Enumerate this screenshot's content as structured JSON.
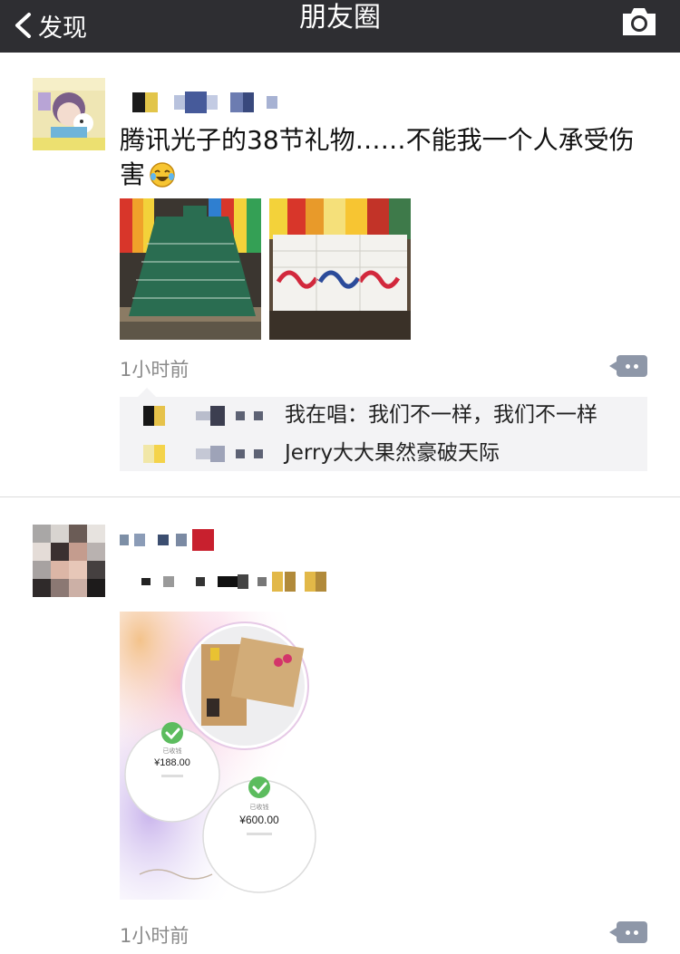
{
  "nav": {
    "back_label": "发现",
    "title": "朋友圈",
    "camera_icon": "camera-icon"
  },
  "posts": [
    {
      "text": "腾讯光子的38节礼物……不能我一个人承受伤害",
      "emoji": "face-with-tears-of-joy",
      "time": "1小时前",
      "comments": [
        {
          "text": "我在唱：我们不一样，我们不一样"
        },
        {
          "text": "Jerry大大果然豪破天际"
        }
      ]
    },
    {
      "time": "1小时前",
      "receipts": [
        {
          "status": "已收钱",
          "amount": "¥188.00"
        },
        {
          "status": "已收钱",
          "amount": "¥600.00"
        }
      ]
    }
  ],
  "colors": {
    "navbar": "#2e2e32",
    "link": "#576b95",
    "time": "#8a8a8a",
    "comment_bg": "#f3f3f5"
  }
}
